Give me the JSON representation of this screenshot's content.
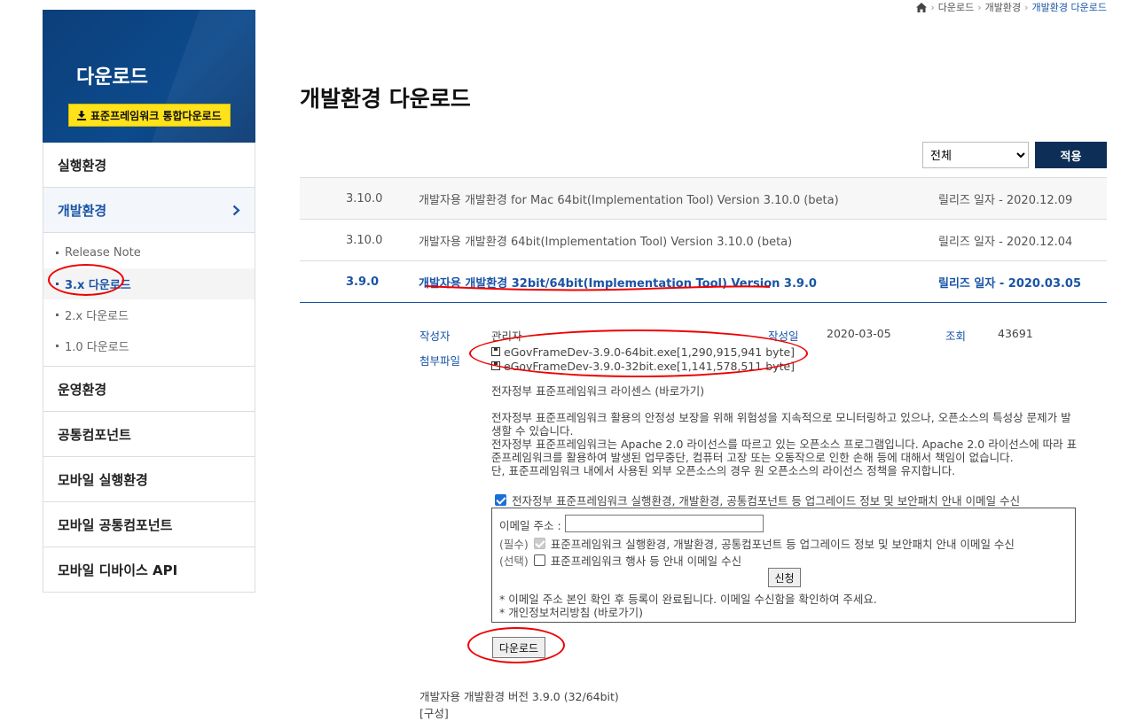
{
  "breadcrumb": {
    "items": [
      "다운로드",
      "개발환경"
    ],
    "current": "개발환경 다운로드"
  },
  "sidebar": {
    "title": "다운로드",
    "integrated_button": "표준프레임워크 통합다운로드",
    "menu": [
      "실행환경",
      "개발환경"
    ],
    "sub_items": [
      "Release Note",
      "3.x 다운로드",
      "2.x 다운로드",
      "1.0 다운로드"
    ],
    "menu_after": [
      "운영환경",
      "공통컴포넌트",
      "모바일 실행환경",
      "모바일 공통컴포넌트",
      "모바일 디바이스 API"
    ]
  },
  "main": {
    "title": "개발환경 다운로드",
    "filter_value": "전체",
    "apply_label": "적용",
    "rows": [
      {
        "version": "3.10.0",
        "title": "개발자용 개발환경 for Mac 64bit(Implementation Tool) Version 3.10.0 (beta)",
        "date": "릴리즈 일자 - 2020.12.09"
      },
      {
        "version": "3.10.0",
        "title": "개발자용 개발환경 64bit(Implementation Tool) Version 3.10.0 (beta)",
        "date": "릴리즈 일자 - 2020.12.04"
      },
      {
        "version": "3.9.0",
        "title": "개발자용 개발환경 32bit/64bit(Implementation Tool) Version 3.9.0",
        "date": "릴리즈 일자 - 2020.03.05"
      }
    ],
    "detail": {
      "author_label": "작성자",
      "author": "관리자",
      "date_label": "작성일",
      "date": "2020-03-05",
      "views_label": "조회",
      "views": "43691",
      "attach_label": "첨부파일",
      "files": [
        "eGovFrameDev-3.9.0-64bit.exe[1,290,915,941 byte]",
        "eGovFrameDev-3.9.0-32bit.exe[1,141,578,511 byte]"
      ],
      "license_link": "전자정부 표준프레임워크 라이센스 (바로가기)",
      "para1": "전자정부 표준프레임워크 활용의 안정성 보장을 위해 위험성을 지속적으로 모니터링하고 있으나, 오픈소스의 특성상 문제가 발생할 수 있습니다.",
      "para2": "전자정부 표준프레임워크는 Apache 2.0 라이선스를 따르고 있는 오픈소스 프로그램입니다. Apache 2.0 라이선스에 따라 표준프레임워크를 활용하여 발생된 업무중단, 컴퓨터 고장 또는 오동작으로 인한 손해 등에 대해서 책임이 없습니다.",
      "para3": "단, 표준프레임워크 내에서 사용된 외부 오픈소스의 경우 원 오픈소스의 라이선스 정책을 유지합니다.",
      "subscribe_label": "전자정부 표준프레임워크 실행환경, 개발환경, 공통컴포넌트 등 업그레이드 정보 및 보안패치 안내 이메일 수신",
      "email_label": "이메일 주소 :",
      "required_tag": "(필수)",
      "required_text": "표준프레임워크 실행환경, 개발환경, 공통컴포넌트 등 업그레이드 정보 및 보안패치 안내 이메일 수신",
      "optional_tag": "(선택)",
      "optional_text": "표준프레임워크 행사 등 안내 이메일 수신",
      "apply_button": "신청",
      "note1": "* 이메일 주소 본인 확인 후 등록이 완료됩니다. 이메일 수신함을 확인하여 주세요.",
      "note2": "* 개인정보처리방침 (바로가기)",
      "download_button": "다운로드",
      "footer1": "개발자용 개발환경 버전 3.9.0 (32/64bit)",
      "footer2": "[구성]"
    }
  }
}
